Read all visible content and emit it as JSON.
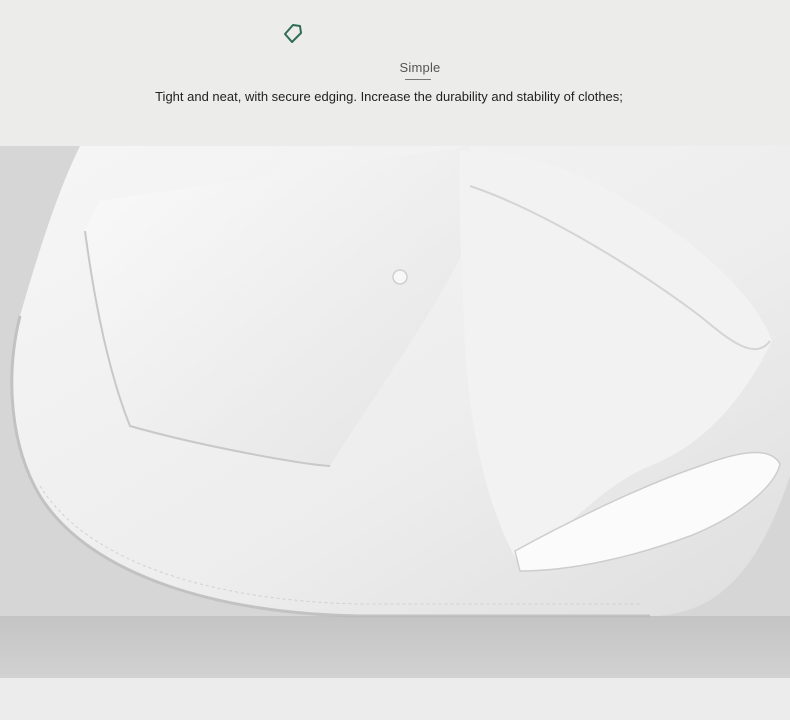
{
  "section": {
    "icon": "tag-icon",
    "heading": "Simple",
    "description": "Tight and neat, with secure edging. Increase the durability and stability of clothes;"
  },
  "photo": {
    "subject": "shirt-hem-detail-photo"
  },
  "colors": {
    "background": "#ececec",
    "icon_accent": "#2f6b55",
    "text": "#222222"
  }
}
